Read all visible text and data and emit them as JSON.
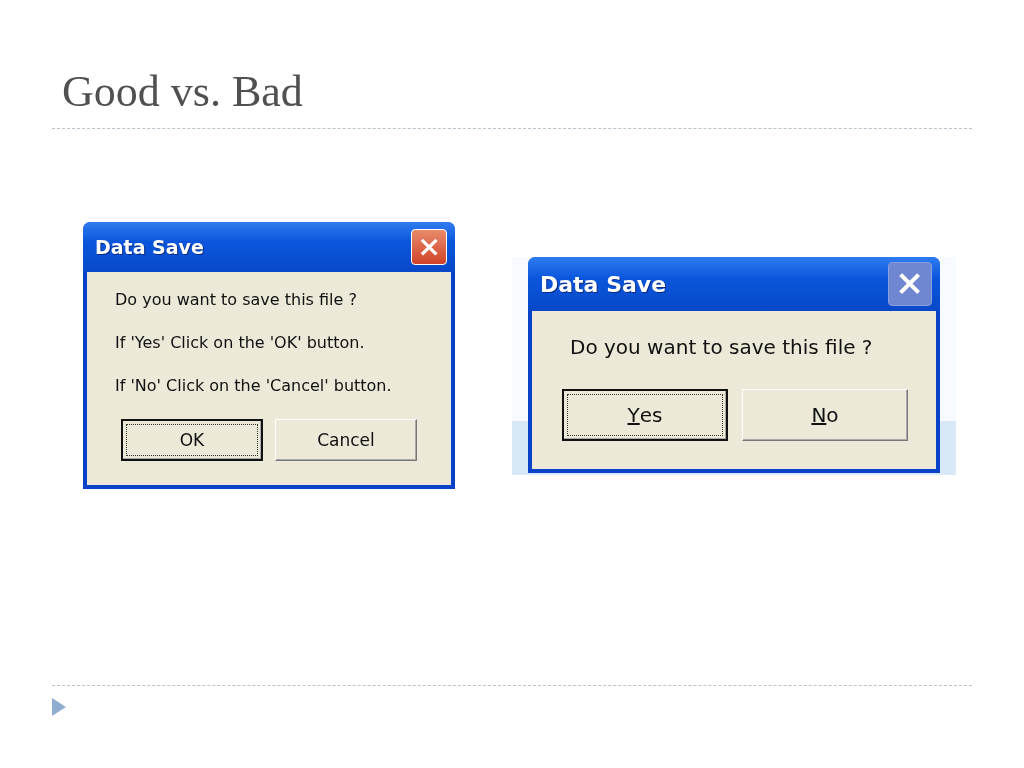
{
  "slide": {
    "title": "Good vs. Bad"
  },
  "dialogs": [
    {
      "title": "Data Save",
      "close_enabled": true,
      "kind": "small",
      "messages": [
        "Do you want to save this file ?",
        "If 'Yes' Click on the 'OK' button.",
        "If 'No' Click on the 'Cancel' button."
      ],
      "buttons": [
        {
          "label": "OK",
          "focused": true,
          "underline_first": false
        },
        {
          "label": "Cancel",
          "focused": false,
          "underline_first": false
        }
      ]
    },
    {
      "title": "Data Save",
      "close_enabled": false,
      "kind": "large",
      "messages": [
        "Do you want to save this file ?"
      ],
      "buttons": [
        {
          "label": "Yes",
          "focused": true,
          "underline_first": true
        },
        {
          "label": "No",
          "focused": false,
          "underline_first": true
        }
      ]
    }
  ]
}
